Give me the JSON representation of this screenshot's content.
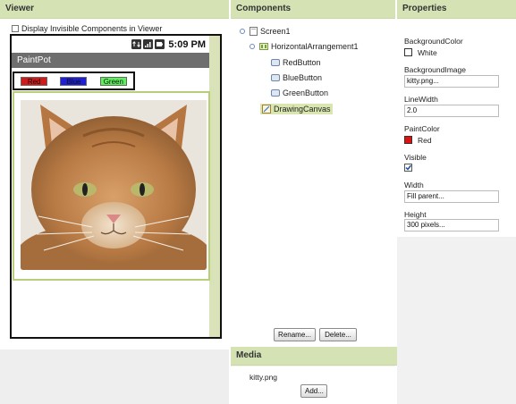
{
  "viewer": {
    "header": "Viewer",
    "display_invisible_label": "Display Invisible Components in Viewer",
    "phone": {
      "status_time": "5:09 PM",
      "app_title": "PaintPot",
      "buttons": [
        {
          "label": "Red",
          "color": "#d11a1a"
        },
        {
          "label": "Blue",
          "color": "#1f1fd6"
        },
        {
          "label": "Green",
          "color": "#5cf05c"
        }
      ]
    }
  },
  "components": {
    "header": "Components",
    "tree": {
      "screen": "Screen1",
      "arrangement": "HorizontalArrangement1",
      "buttons": [
        "RedButton",
        "BlueButton",
        "GreenButton"
      ],
      "canvas": "DrawingCanvas"
    },
    "rename_label": "Rename...",
    "delete_label": "Delete..."
  },
  "media": {
    "header": "Media",
    "file": "kitty.png",
    "add_label": "Add..."
  },
  "properties": {
    "header": "Properties",
    "background_color_label": "BackgroundColor",
    "background_color_value": "White",
    "background_image_label": "BackgroundImage",
    "background_image_value": "kitty.png...",
    "line_width_label": "LineWidth",
    "line_width_value": "2.0",
    "paint_color_label": "PaintColor",
    "paint_color_value": "Red",
    "paint_color_hex": "#e01010",
    "visible_label": "Visible",
    "visible_checked": true,
    "width_label": "Width",
    "width_value": "Fill parent...",
    "height_label": "Height",
    "height_value": "300 pixels..."
  },
  "colors": {
    "header_bg": "#d5e3b4",
    "accent": "#b8cf79"
  }
}
